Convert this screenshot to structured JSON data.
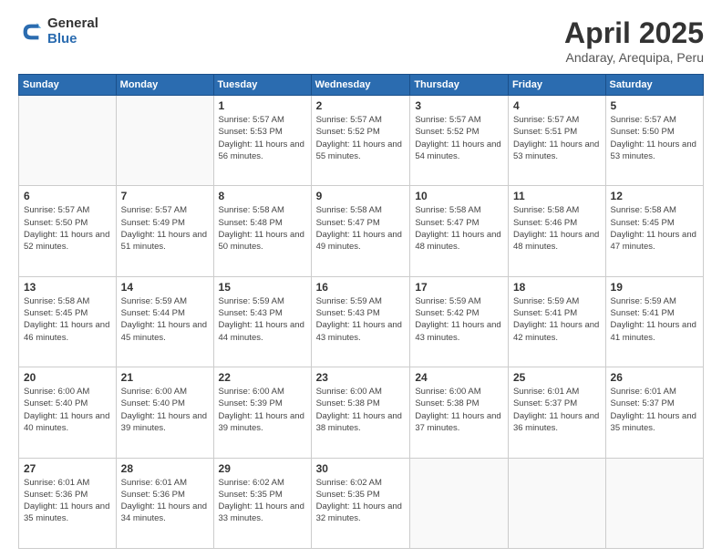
{
  "logo": {
    "general": "General",
    "blue": "Blue"
  },
  "title": "April 2025",
  "subtitle": "Andaray, Arequipa, Peru",
  "days_of_week": [
    "Sunday",
    "Monday",
    "Tuesday",
    "Wednesday",
    "Thursday",
    "Friday",
    "Saturday"
  ],
  "weeks": [
    [
      {
        "day": "",
        "info": ""
      },
      {
        "day": "",
        "info": ""
      },
      {
        "day": "1",
        "info": "Sunrise: 5:57 AM\nSunset: 5:53 PM\nDaylight: 11 hours and 56 minutes."
      },
      {
        "day": "2",
        "info": "Sunrise: 5:57 AM\nSunset: 5:52 PM\nDaylight: 11 hours and 55 minutes."
      },
      {
        "day": "3",
        "info": "Sunrise: 5:57 AM\nSunset: 5:52 PM\nDaylight: 11 hours and 54 minutes."
      },
      {
        "day": "4",
        "info": "Sunrise: 5:57 AM\nSunset: 5:51 PM\nDaylight: 11 hours and 53 minutes."
      },
      {
        "day": "5",
        "info": "Sunrise: 5:57 AM\nSunset: 5:50 PM\nDaylight: 11 hours and 53 minutes."
      }
    ],
    [
      {
        "day": "6",
        "info": "Sunrise: 5:57 AM\nSunset: 5:50 PM\nDaylight: 11 hours and 52 minutes."
      },
      {
        "day": "7",
        "info": "Sunrise: 5:57 AM\nSunset: 5:49 PM\nDaylight: 11 hours and 51 minutes."
      },
      {
        "day": "8",
        "info": "Sunrise: 5:58 AM\nSunset: 5:48 PM\nDaylight: 11 hours and 50 minutes."
      },
      {
        "day": "9",
        "info": "Sunrise: 5:58 AM\nSunset: 5:47 PM\nDaylight: 11 hours and 49 minutes."
      },
      {
        "day": "10",
        "info": "Sunrise: 5:58 AM\nSunset: 5:47 PM\nDaylight: 11 hours and 48 minutes."
      },
      {
        "day": "11",
        "info": "Sunrise: 5:58 AM\nSunset: 5:46 PM\nDaylight: 11 hours and 48 minutes."
      },
      {
        "day": "12",
        "info": "Sunrise: 5:58 AM\nSunset: 5:45 PM\nDaylight: 11 hours and 47 minutes."
      }
    ],
    [
      {
        "day": "13",
        "info": "Sunrise: 5:58 AM\nSunset: 5:45 PM\nDaylight: 11 hours and 46 minutes."
      },
      {
        "day": "14",
        "info": "Sunrise: 5:59 AM\nSunset: 5:44 PM\nDaylight: 11 hours and 45 minutes."
      },
      {
        "day": "15",
        "info": "Sunrise: 5:59 AM\nSunset: 5:43 PM\nDaylight: 11 hours and 44 minutes."
      },
      {
        "day": "16",
        "info": "Sunrise: 5:59 AM\nSunset: 5:43 PM\nDaylight: 11 hours and 43 minutes."
      },
      {
        "day": "17",
        "info": "Sunrise: 5:59 AM\nSunset: 5:42 PM\nDaylight: 11 hours and 43 minutes."
      },
      {
        "day": "18",
        "info": "Sunrise: 5:59 AM\nSunset: 5:41 PM\nDaylight: 11 hours and 42 minutes."
      },
      {
        "day": "19",
        "info": "Sunrise: 5:59 AM\nSunset: 5:41 PM\nDaylight: 11 hours and 41 minutes."
      }
    ],
    [
      {
        "day": "20",
        "info": "Sunrise: 6:00 AM\nSunset: 5:40 PM\nDaylight: 11 hours and 40 minutes."
      },
      {
        "day": "21",
        "info": "Sunrise: 6:00 AM\nSunset: 5:40 PM\nDaylight: 11 hours and 39 minutes."
      },
      {
        "day": "22",
        "info": "Sunrise: 6:00 AM\nSunset: 5:39 PM\nDaylight: 11 hours and 39 minutes."
      },
      {
        "day": "23",
        "info": "Sunrise: 6:00 AM\nSunset: 5:38 PM\nDaylight: 11 hours and 38 minutes."
      },
      {
        "day": "24",
        "info": "Sunrise: 6:00 AM\nSunset: 5:38 PM\nDaylight: 11 hours and 37 minutes."
      },
      {
        "day": "25",
        "info": "Sunrise: 6:01 AM\nSunset: 5:37 PM\nDaylight: 11 hours and 36 minutes."
      },
      {
        "day": "26",
        "info": "Sunrise: 6:01 AM\nSunset: 5:37 PM\nDaylight: 11 hours and 35 minutes."
      }
    ],
    [
      {
        "day": "27",
        "info": "Sunrise: 6:01 AM\nSunset: 5:36 PM\nDaylight: 11 hours and 35 minutes."
      },
      {
        "day": "28",
        "info": "Sunrise: 6:01 AM\nSunset: 5:36 PM\nDaylight: 11 hours and 34 minutes."
      },
      {
        "day": "29",
        "info": "Sunrise: 6:02 AM\nSunset: 5:35 PM\nDaylight: 11 hours and 33 minutes."
      },
      {
        "day": "30",
        "info": "Sunrise: 6:02 AM\nSunset: 5:35 PM\nDaylight: 11 hours and 32 minutes."
      },
      {
        "day": "",
        "info": ""
      },
      {
        "day": "",
        "info": ""
      },
      {
        "day": "",
        "info": ""
      }
    ]
  ]
}
